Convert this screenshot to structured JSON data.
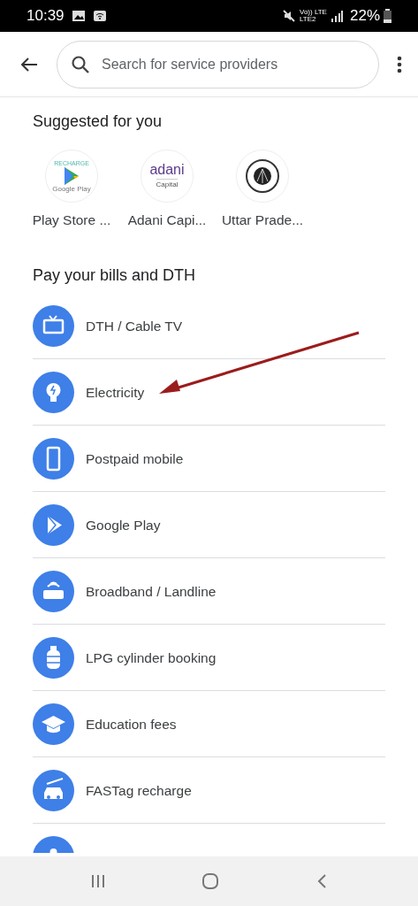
{
  "status_bar": {
    "time": "10:39",
    "network": "Vo)) LTE",
    "network_2": "LTE2",
    "battery": "22%"
  },
  "search": {
    "placeholder": "Search for service providers"
  },
  "suggested": {
    "title": "Suggested for you",
    "items": [
      {
        "label": "Play Store ...",
        "kind": "play",
        "logo_lines": [
          "RECHARGE",
          "Google Play"
        ]
      },
      {
        "label": "Adani Capi...",
        "kind": "adani",
        "logo_lines": [
          "adani",
          "Capital"
        ]
      },
      {
        "label": "Uttar Prade...",
        "kind": "emblem"
      }
    ]
  },
  "bills": {
    "title": "Pay your bills and DTH",
    "items": [
      {
        "label": "DTH / Cable TV",
        "kind": "tv"
      },
      {
        "label": "Electricity",
        "kind": "bulb"
      },
      {
        "label": "Postpaid mobile",
        "kind": "phone"
      },
      {
        "label": "Google Play",
        "kind": "play"
      },
      {
        "label": "Broadband / Landline",
        "kind": "router"
      },
      {
        "label": "LPG cylinder booking",
        "kind": "cylinder"
      },
      {
        "label": "Education fees",
        "kind": "cap"
      },
      {
        "label": "FASTag recharge",
        "kind": "car"
      },
      {
        "kind": "drop"
      }
    ]
  },
  "annotation": {
    "kind": "arrow",
    "color": "#9b1c1c"
  }
}
